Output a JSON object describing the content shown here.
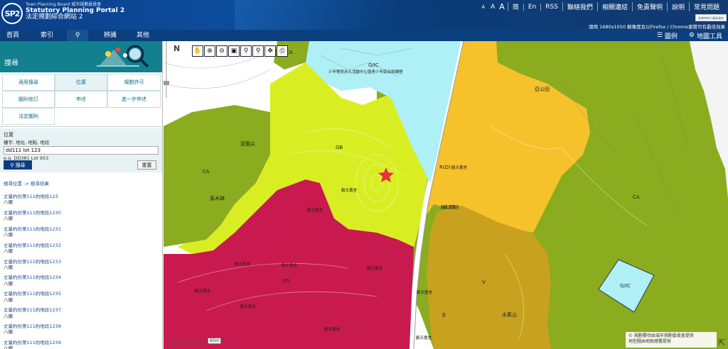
{
  "header": {
    "logo_text": "SP2",
    "brand_line1": "Town Planning Board 城市規劃委員會",
    "brand_line2": "Statutory Planning Portal 2",
    "brand_line3": "法定規劃綜合網站 2",
    "top_links": [
      "A",
      "A",
      "A",
      "简",
      "En",
      "RSS",
      "聯絡我們",
      "相關連結",
      "免責聲明",
      "說明",
      "常見問題"
    ],
    "gov_badge": "香港特別行政區政府",
    "resolution_note": "請用 1680x1050 解像度及以Firefox / Chrome瀏覽可有最佳效果"
  },
  "menu": {
    "items": [
      "首頁",
      "索引",
      "",
      "辨識",
      "其他"
    ],
    "search_icon": "search-icon",
    "legend_label": "圖例",
    "map_tools_label": "地圖工具"
  },
  "panel": {
    "title": "搜尋",
    "tabs": [
      "適用搜尋",
      "位置",
      "規劃許可",
      "圖則修訂",
      "申述",
      "進一步申述",
      "法定圖則"
    ],
    "location_label": "位置",
    "location_hint": "樓宇, 地址, 地點, 地段",
    "location_value": "dd111 lot 123",
    "location_example": "e.g. DD381 Lot 953",
    "search_button": "搜尋",
    "reset_button": "重置",
    "breadcrumb": "搜尋位置 -> 搜尋結果",
    "results": [
      {
        "title": "丈量約份第111約地段123",
        "sub": "八鄉"
      },
      {
        "title": "丈量約份第111約地段1230",
        "sub": "八鄉"
      },
      {
        "title": "丈量約份第111約地段1231",
        "sub": "八鄉"
      },
      {
        "title": "丈量約份第111約地段1232",
        "sub": "八鄉"
      },
      {
        "title": "丈量約份第111約地段1233",
        "sub": "八鄉"
      },
      {
        "title": "丈量約份第111約地段1234",
        "sub": "八鄉"
      },
      {
        "title": "丈量約份第111約地段1235",
        "sub": "八鄉"
      },
      {
        "title": "丈量約份第111約地段1237",
        "sub": "八鄉"
      },
      {
        "title": "丈量約份第111約地段1238",
        "sub": "八鄉"
      },
      {
        "title": "丈量約份第111約地段1239",
        "sub": "八鄉"
      }
    ]
  },
  "map": {
    "north": "N",
    "scale_label": "60m",
    "copyright_line1": "© 規劃署待由城市規劃委員會提供",
    "copyright_line2": "地型圖由地政總署提供",
    "zone_labels": {
      "ca_top": "CA",
      "gic_top": "G/IC",
      "gic_center_name": "少年警訊永久活動中心暨青少年綜合訓練營",
      "gb": "GB",
      "niwu": "泥圍尖",
      "ca_left": "CA",
      "ma": "馬木碑",
      "rd": "R(D)",
      "ya_gong": "亞公田",
      "ca_right": "CA",
      "gic_right": "G/IC",
      "v": "V",
      "os": "OS",
      "sui_lung": "水蕉山",
      "laam": "藍",
      "farm": [
        "鶴天農舍",
        "鶴天農舍",
        "鶴天農舍",
        "鶴天農舍",
        "鶴天農舍",
        "鶴天農舍",
        "鶴天農舍",
        "鶴天農舍",
        "鶴天農舍",
        "鶴天農舍",
        "鶴天農舍",
        "鶴天農舍",
        "鶴天農舍"
      ]
    },
    "colors": {
      "ca": "#8aac1e",
      "gic": "#aef0f5",
      "gb": "#d8ee23",
      "os": "#c81a4e",
      "rd": "#f5c22c",
      "v": "#c8a21e",
      "road": "#ffffff",
      "highlight": "#e33"
    }
  }
}
